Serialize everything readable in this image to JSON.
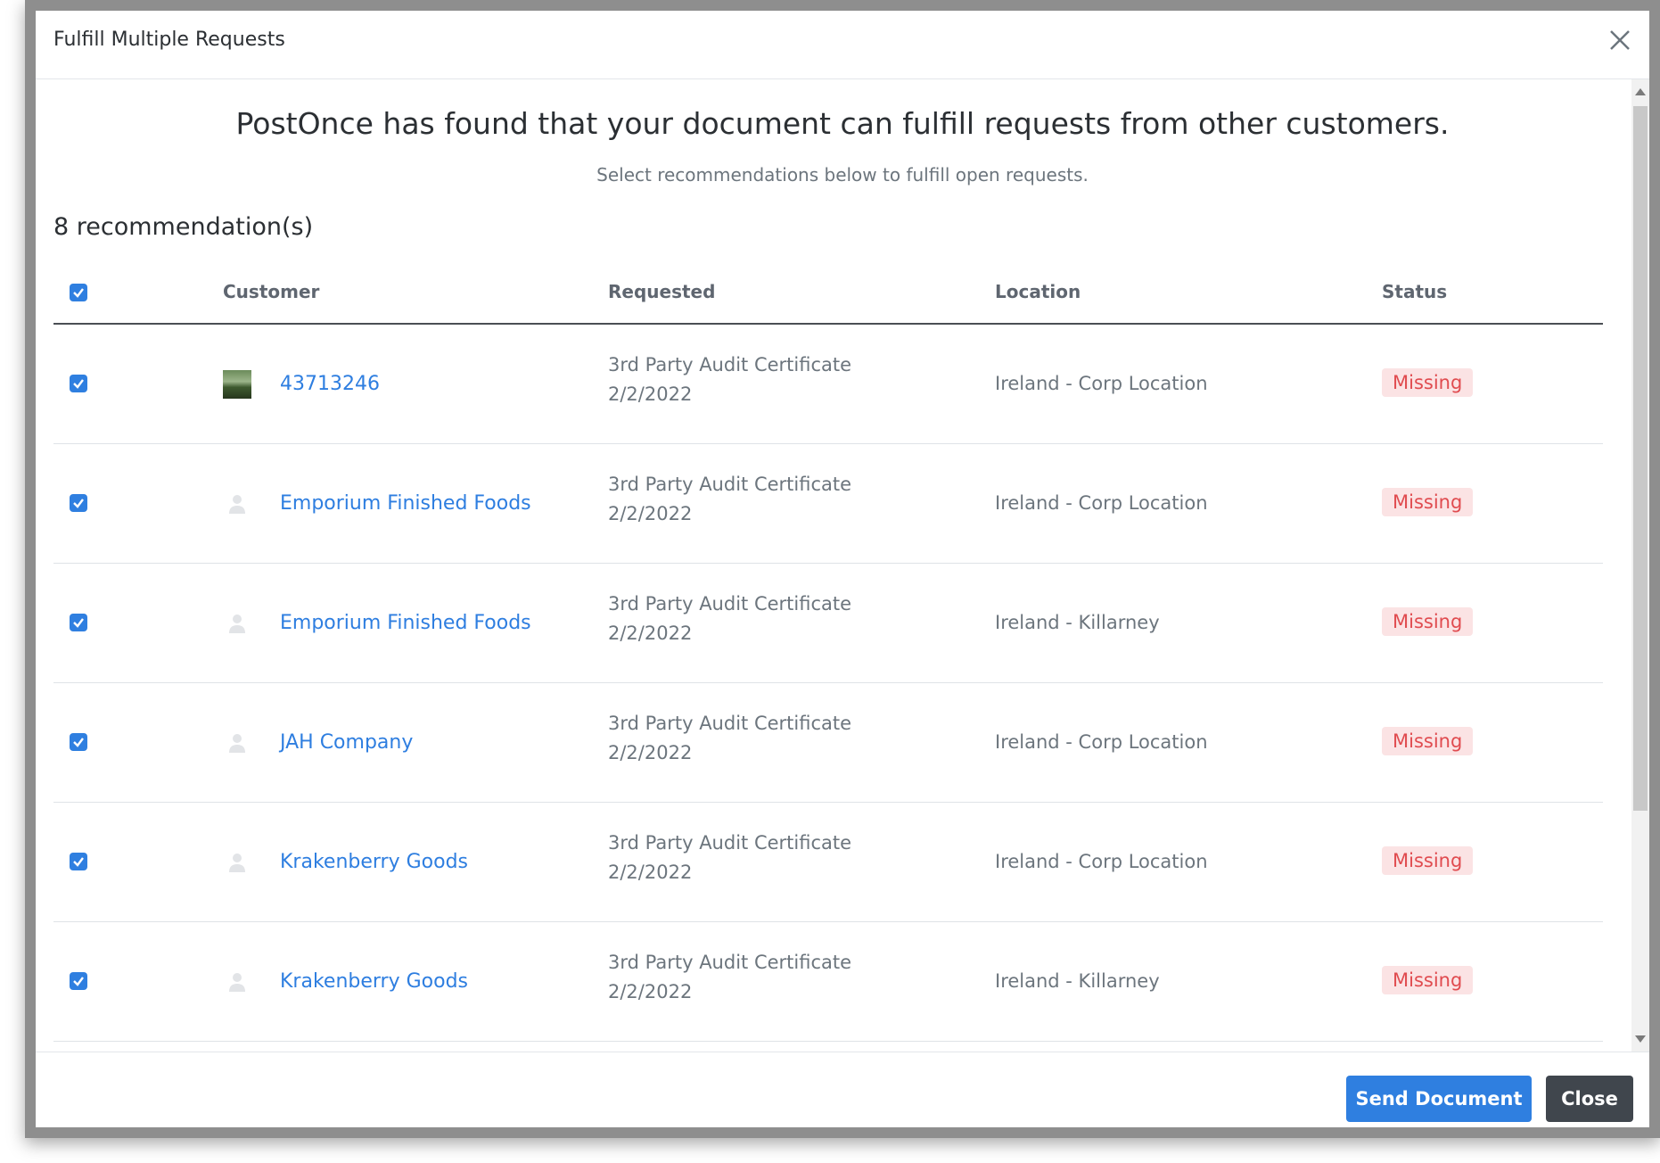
{
  "dialog": {
    "title": "Fulfill Multiple Requests",
    "headline": "PostOnce has found that your document can fulfill requests from other customers.",
    "subline": "Select recommendations below to fulfill open requests.",
    "recommendation_count": "8 recommendation(s)"
  },
  "table": {
    "headers": {
      "customer": "Customer",
      "requested": "Requested",
      "location": "Location",
      "status": "Status"
    },
    "select_all_checked": true,
    "rows": [
      {
        "checked": true,
        "avatar": "photo",
        "customer": "43713246",
        "document": "3rd Party Audit Certificate",
        "date": "2/2/2022",
        "location": "Ireland - Corp Location",
        "status": "Missing"
      },
      {
        "checked": true,
        "avatar": "placeholder-user-icon",
        "customer": "Emporium Finished Foods",
        "document": "3rd Party Audit Certificate",
        "date": "2/2/2022",
        "location": "Ireland - Corp Location",
        "status": "Missing"
      },
      {
        "checked": true,
        "avatar": "placeholder-user-icon",
        "customer": "Emporium Finished Foods",
        "document": "3rd Party Audit Certificate",
        "date": "2/2/2022",
        "location": "Ireland - Killarney",
        "status": "Missing"
      },
      {
        "checked": true,
        "avatar": "placeholder-user-icon",
        "customer": "JAH Company",
        "document": "3rd Party Audit Certificate",
        "date": "2/2/2022",
        "location": "Ireland - Corp Location",
        "status": "Missing"
      },
      {
        "checked": true,
        "avatar": "placeholder-user-icon",
        "customer": "Krakenberry Goods",
        "document": "3rd Party Audit Certificate",
        "date": "2/2/2022",
        "location": "Ireland - Corp Location",
        "status": "Missing"
      },
      {
        "checked": true,
        "avatar": "placeholder-user-icon",
        "customer": "Krakenberry Goods",
        "document": "3rd Party Audit Certificate",
        "date": "2/2/2022",
        "location": "Ireland - Killarney",
        "status": "Missing"
      }
    ]
  },
  "footer": {
    "send_label": "Send Document",
    "close_label": "Close"
  },
  "colors": {
    "accent": "#2f7fe0",
    "status_missing_text": "#e04b4f",
    "status_missing_bg": "#fbe3e4",
    "close_button": "#40464d"
  }
}
